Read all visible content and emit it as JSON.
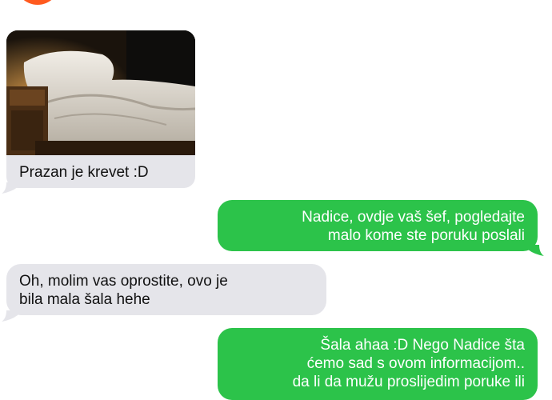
{
  "colors": {
    "incoming_bubble": "#e5e5ea",
    "outgoing_bubble": "#2cc34a",
    "avatar": "#ff5a1f"
  },
  "avatar": {
    "icon": "smiley-face-icon"
  },
  "messages": [
    {
      "sender": "contact",
      "type": "image",
      "image": "bed-photo",
      "caption": "Prazan je krevet :D"
    },
    {
      "sender": "me",
      "lines": [
        "Nadice, ovdje vaš šef, pogledajte",
        "malo kome ste poruku poslali"
      ]
    },
    {
      "sender": "contact",
      "lines": [
        "Oh, molim vas oprostite, ovo je",
        "bila mala šala hehe"
      ]
    },
    {
      "sender": "me",
      "lines": [
        "Šala ahaa :D Nego Nadice šta",
        "ćemo sad s ovom informacijom..",
        "da li da mužu proslijedim poruke ili"
      ]
    }
  ]
}
